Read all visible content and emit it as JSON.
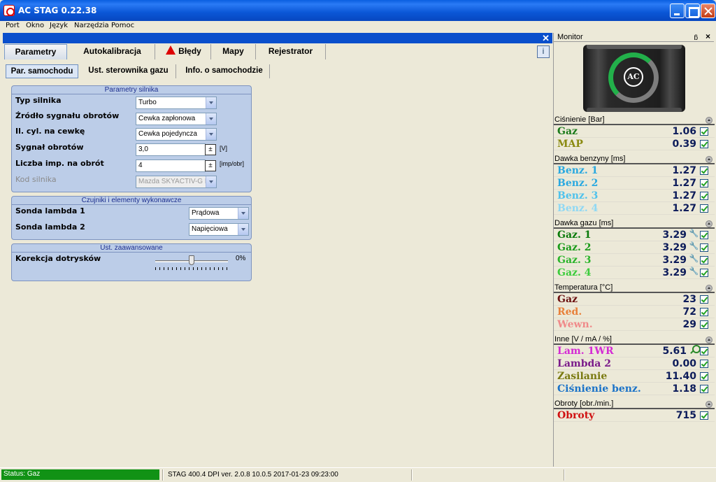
{
  "window": {
    "title": "AC STAG 0.22.38"
  },
  "menu": [
    "Port",
    "Okno",
    "Język",
    "Narzędzia",
    "Pomoc"
  ],
  "tabs": [
    "Parametry",
    "Autokalibracja",
    "Błędy",
    "Mapy",
    "Rejestrator"
  ],
  "active_tab": "Parametry",
  "help_button": "i",
  "subtabs": [
    "Par. samochodu",
    "Ust. sterownika gazu",
    "Info. o samochodzie"
  ],
  "engine_group": {
    "title": "Parametry silnika",
    "fields": [
      {
        "label": "Typ silnika",
        "value": "Turbo",
        "kind": "select"
      },
      {
        "label": "Źródło sygnału obrotów",
        "value": "Cewka zapłonowa",
        "kind": "select"
      },
      {
        "label": "Il. cyl. na cewkę",
        "value": "Cewka pojedyncza",
        "kind": "select"
      },
      {
        "label": "Sygnał obrotów",
        "value": "3,0",
        "kind": "spin",
        "unit": "[V]"
      },
      {
        "label": "Liczba imp. na obrót",
        "value": "4",
        "kind": "spin",
        "unit": "[imp/obr]"
      },
      {
        "label": "Kod silnika",
        "value": "Mazda SKYACTIV-G PY-",
        "kind": "select",
        "disabled": true
      }
    ]
  },
  "sensors_group": {
    "title": "Czujniki i elementy wykonawcze",
    "fields": [
      {
        "label": "Sonda lambda 1",
        "value": "Prądowa"
      },
      {
        "label": "Sonda lambda 2",
        "value": "Napięciowa"
      }
    ]
  },
  "advanced_group": {
    "title": "Ust. zaawansowane",
    "label": "Korekcja dotrysków",
    "value": "0%",
    "slider_fraction": 0.5
  },
  "status": {
    "left": "Status: Gaz",
    "info": "STAG 400.4 DPI  ver. 2.0.8  10.0.5   2017-01-23 09:23:00"
  },
  "monitor": {
    "title": "Monitor",
    "pin": "ꟷ",
    "close": "×",
    "logo": "AC",
    "sections": [
      {
        "title": "Ciśnienie [Bar]",
        "rows": [
          {
            "label": "Gaz",
            "value": "1.06",
            "color": "#1a7a1a"
          },
          {
            "label": "MAP",
            "value": "0.39",
            "color": "#8a8a10"
          }
        ]
      },
      {
        "title": "Dawka benzyny [ms]",
        "rows": [
          {
            "label": "Benz. 1",
            "value": "1.27",
            "color": "#29a8e0"
          },
          {
            "label": "Benz. 2",
            "value": "1.27",
            "color": "#29a8e0"
          },
          {
            "label": "Benz. 3",
            "value": "1.27",
            "color": "#4fc2ec"
          },
          {
            "label": "Benz. 4",
            "value": "1.27",
            "color": "#8fd8f4"
          }
        ]
      },
      {
        "title": "Dawka gazu [ms]",
        "rows": [
          {
            "label": "Gaz. 1",
            "value": "3.29",
            "color": "#0a7a0a",
            "icon": "injector-icon"
          },
          {
            "label": "Gaz. 2",
            "value": "3.29",
            "color": "#1a9a1a",
            "icon": "injector-icon"
          },
          {
            "label": "Gaz. 3",
            "value": "3.29",
            "color": "#2ab42a",
            "icon": "injector-icon"
          },
          {
            "label": "Gaz. 4",
            "value": "3.29",
            "color": "#3ccc3c",
            "icon": "injector-icon"
          }
        ]
      },
      {
        "title": "Temperatura [°C]",
        "rows": [
          {
            "label": "Gaz",
            "value": "23",
            "color": "#6a1010"
          },
          {
            "label": "Red.",
            "value": "72",
            "color": "#e8803a"
          },
          {
            "label": "Wewn.",
            "value": "29",
            "color": "#f08a8a"
          }
        ]
      },
      {
        "title": "Inne [V / mA / %]",
        "rows": [
          {
            "label": "Lam. 1WR",
            "value": "5.61",
            "color": "#d42ad4",
            "icon": "zoom-icon"
          },
          {
            "label": "Lambda 2",
            "value": "0.00",
            "color": "#7a1a8a"
          },
          {
            "label": "Zasilanie",
            "value": "11.40",
            "color": "#7a7a10"
          },
          {
            "label": "Ciśnienie benz.",
            "value": "1.18",
            "color": "#1a72c8"
          }
        ]
      },
      {
        "title": "Obroty [obr./min.]",
        "rows": [
          {
            "label": "Obroty",
            "value": "715",
            "color": "#d01010"
          }
        ]
      }
    ]
  }
}
